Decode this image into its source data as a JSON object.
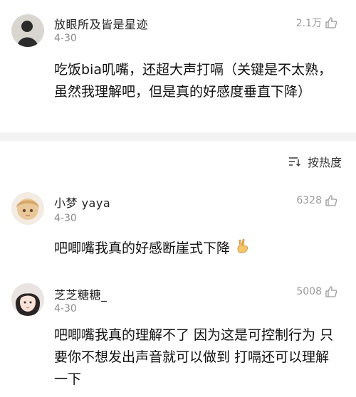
{
  "comments": [
    {
      "username": "放眼所及皆是星迹",
      "date": "4-30",
      "likes": "2.1万",
      "text": "吃饭bia叽嘴，还超大声打嗝（关键是不太熟，虽然我理解吧，但是真的好感度垂直下降）"
    },
    {
      "username": "小梦 yaya",
      "date": "4-30",
      "likes": "6328",
      "text": "吧唧嘴我真的好感断崖式下降",
      "emoji": "victory-hand-icon"
    },
    {
      "username": "芝芝糖糖_",
      "date": "4-30",
      "likes": "5008",
      "text": "吧唧嘴我真的理解不了 因为这是可控制行为 只要你不想发出声音就可以做到 打嗝还可以理解一下"
    }
  ],
  "sort": {
    "label": "按热度",
    "icon": "sort-icon"
  }
}
